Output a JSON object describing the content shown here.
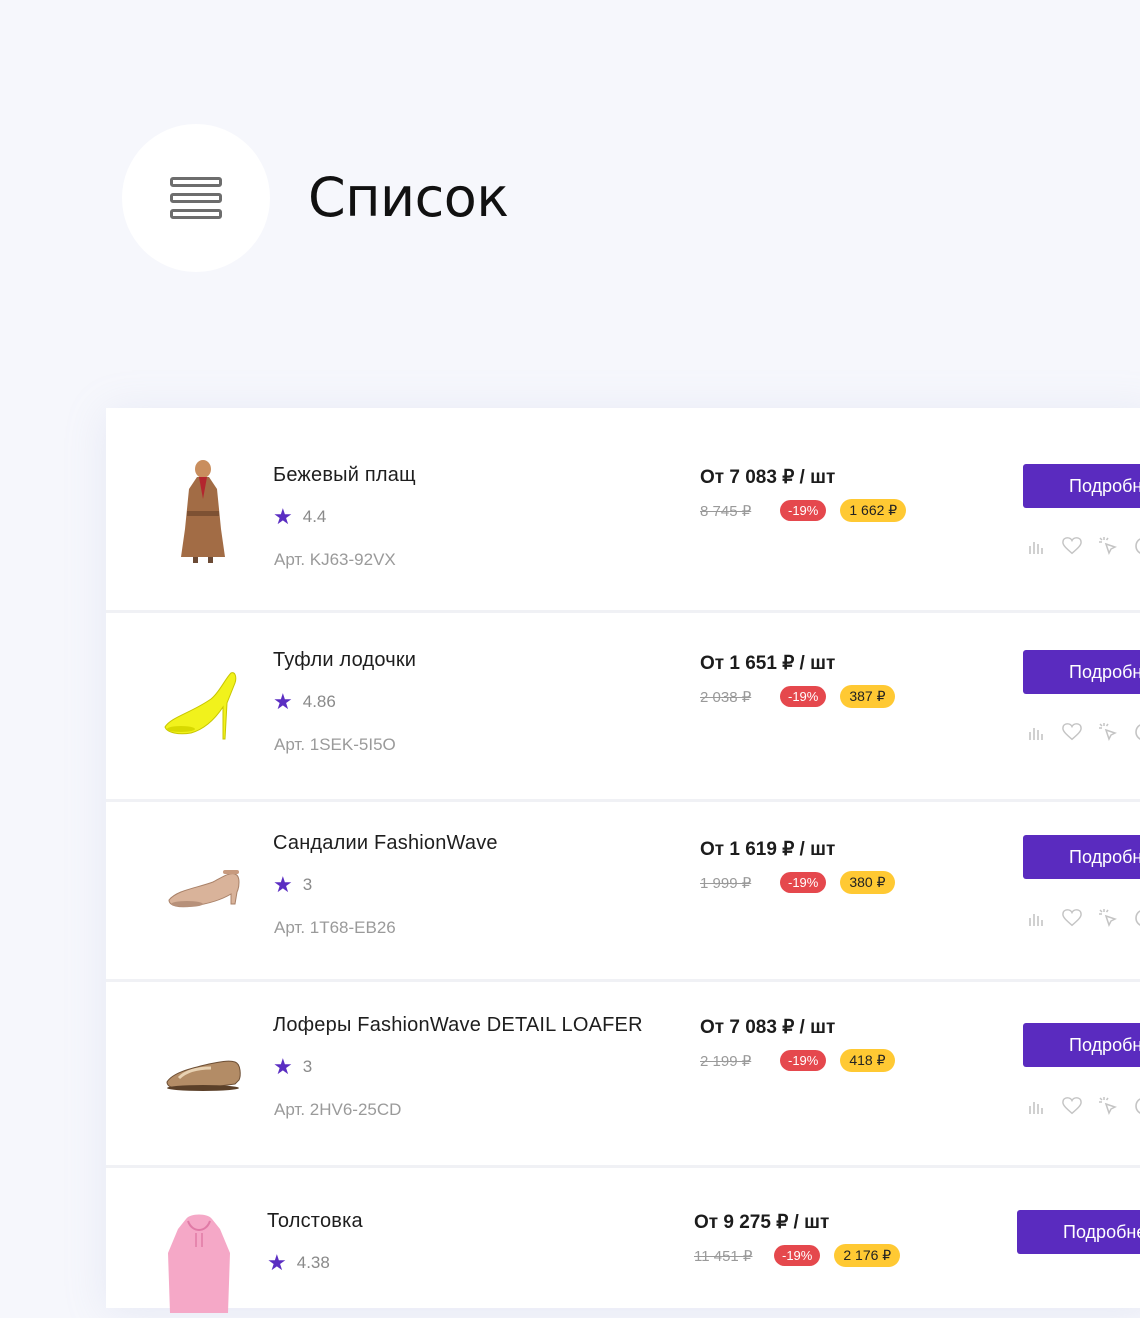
{
  "header": {
    "title": "Список",
    "icon": "list-view-icon"
  },
  "colors": {
    "accent": "#5a2bbf",
    "discount": "#e5484d",
    "bonus": "#ffc933",
    "background": "#f6f7fc"
  },
  "products": [
    {
      "name": "Бежевый плащ",
      "rating": "4.4",
      "sku": "Арт. KJ63-92VX",
      "price": "От 7 083 ₽ / шт",
      "old_price": "8 745 ₽",
      "discount": "-19%",
      "bonus": "1 662 ₽",
      "button": "Подробнее",
      "image": "beige-coat"
    },
    {
      "name": "Туфли лодочки",
      "rating": "4.86",
      "sku": "Арт. 1SEK-5I5O",
      "price": "От 1 651 ₽ / шт",
      "old_price": "2 038 ₽",
      "discount": "-19%",
      "bonus": "387 ₽",
      "button": "Подробнее",
      "image": "yellow-pumps"
    },
    {
      "name": "Сандалии FashionWave",
      "rating": "3",
      "sku": "Арт. 1T68-EB26",
      "price": "От 1 619 ₽ / шт",
      "old_price": "1 999 ₽",
      "discount": "-19%",
      "bonus": "380 ₽",
      "button": "Подробнее",
      "image": "gold-sandals"
    },
    {
      "name": "Лоферы FashionWave DETAIL LOAFER",
      "rating": "3",
      "sku": "Арт. 2HV6-25CD",
      "price": "От 7 083 ₽ / шт",
      "old_price": "2 199 ₽",
      "discount": "-19%",
      "bonus": "418 ₽",
      "button": "Подробнее",
      "image": "bronze-loafers"
    },
    {
      "name": "Толстовка",
      "rating": "4.38",
      "sku": "",
      "price": "От 9 275 ₽ / шт",
      "old_price": "11 451 ₽",
      "discount": "-19%",
      "bonus": "2 176 ₽",
      "button": "Подробнее",
      "image": "pink-hoodie"
    }
  ]
}
